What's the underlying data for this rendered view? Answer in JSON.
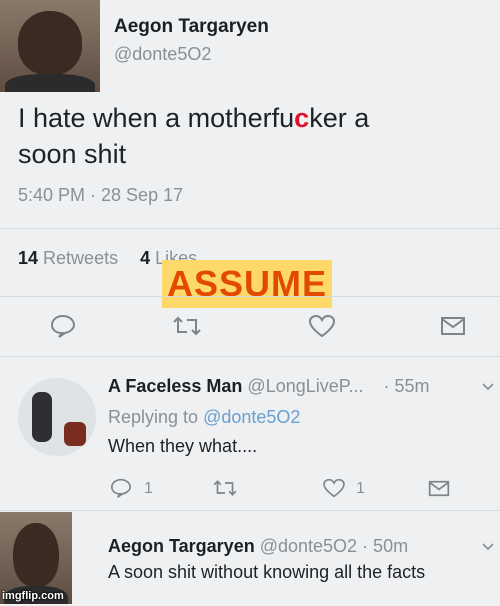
{
  "main_tweet": {
    "display_name": "Aegon Targaryen",
    "handle": "@donte5O2",
    "text_line1": "I hate when a motherfu",
    "text_censored": "c",
    "text_line1_end": "ker a",
    "text_line2": "soon shit",
    "timestamp": "5:40 PM · 28 Sep 17",
    "retweets_count": "14",
    "retweets_label": "Retweets",
    "likes_count": "4",
    "likes_label": "Likes"
  },
  "overlay": {
    "caption": "ASSUME"
  },
  "reply_tweet": {
    "display_name": "A Faceless Man",
    "handle": "@LongLiveP...",
    "age": "· 55m",
    "replying_prefix": "Replying to",
    "replying_handle": "@donte5O2",
    "text": "When they what....",
    "reply_count": "1",
    "like_count": "1"
  },
  "bottom_tweet": {
    "display_name": "Aegon Targaryen",
    "handle_time": "@donte5O2 · 50m",
    "text": "A soon shit without knowing all the facts"
  },
  "watermark": "imgflip.com"
}
